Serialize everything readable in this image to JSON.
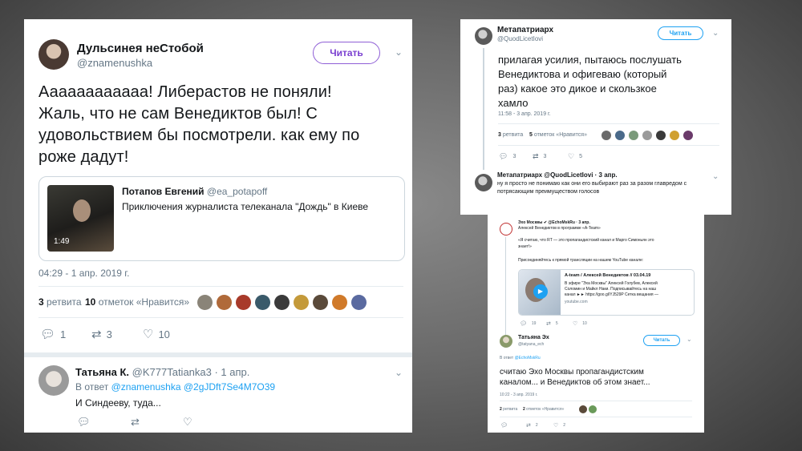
{
  "main": {
    "author_name": "Дульсинея неСтобой",
    "author_handle": "@znamenushka",
    "follow_label": "Читать",
    "text_lines": [
      "Аааааааааааа! Либерастов не поняли!",
      "Жаль, что не сам Венедиктов был! С",
      "удовольствием бы посмотрели. как ему по",
      "роже дадут!"
    ],
    "quote": {
      "name": "Потапов Евгений",
      "handle": "@ea_potapoff",
      "text": "Приключения журналиста телеканала \"Дождь\" в Киеве",
      "duration": "1:49"
    },
    "time": "04:29 - 1 апр. 2019 г.",
    "retweets_count": "3",
    "retweets_label": "ретвита",
    "likes_count": "10",
    "likes_label": "отметок «Нравится»",
    "action_replies": "1",
    "action_retweets": "3",
    "action_likes": "10",
    "reply": {
      "name": "Татьяна К.",
      "handle": "@K777Tatianka3 · 1 апр.",
      "in_reply_prefix": "В ответ",
      "in_reply_to": "@znamenushka @2gJDft7Se4M7O39",
      "text": "И Синдееву, туда..."
    }
  },
  "right_top": {
    "author_name": "Метапатриарх",
    "author_handle": "@QuodLicetIovi",
    "follow_label": "Читать",
    "text_lines": [
      "прилагая усилия, пытаюсь послушать",
      "Венедиктова и офигеваю (который",
      "раз) какое это дикое и скользкое",
      "хамло"
    ],
    "time": "11:58 - 3 апр. 2019 г.",
    "retweets_count": "3",
    "retweets_label": "ретвита",
    "likes_count": "5",
    "likes_label": "отметок «Нравится»",
    "action_replies": "3",
    "action_retweets": "3",
    "action_likes": "5",
    "reply": {
      "header": "Метапатриарх @QuodLicetIovi · 3 апр.",
      "line1": "ну я просто не понимаю как они его выбирают раз за разом главредом с",
      "line2": "потрясающим преимуществом голосов"
    }
  },
  "right_bottom": {
    "orig_header": "Эхо Москвы ✔ @EchoMskRu · 3 апр.",
    "orig_line1": "Алексей Венедиктов в программе «А-Team»",
    "orig_quote1": "«Я считаю, что RT — это пропагандистский канал и Марго Симоньян это",
    "orig_quote2": "знает!»",
    "orig_line3": "Присоединяйтесь к прямой трансляции на нашем YouTube канале:",
    "card": {
      "title": "A-team / Алексей Венедиктов // 03.04.19",
      "desc1": "В эфире \"Эха Москвы\" Алексей Голубев, Алексей",
      "desc2": "Соломин и Майкл Наки. Подписывайтесь на наш",
      "desc3": "канал ►► https://goo.gl/YJ529P Сетка вещания —",
      "domain": "youtube.com"
    },
    "orig_replies": "19",
    "orig_retweets": "5",
    "orig_likes": "10",
    "author_name": "Татьяна Эх",
    "author_handle": "@tatyana_ech",
    "follow_label": "Читать",
    "in_reply_prefix": "В ответ",
    "in_reply_to": "@EchoMskRu",
    "text_lines": [
      "считаю Эхо Москвы пропагандистским",
      "каналом... и Венедиктов об этом знает..."
    ],
    "time": "10:22 - 3 апр. 2019 г.",
    "retweets_count": "2",
    "retweets_label": "ретвита",
    "likes_count": "2",
    "likes_label": "отметок «Нравится»",
    "action_retweets": "2",
    "action_likes": "2"
  },
  "colors": {
    "accent": "#1da1f2",
    "follow_purple": "#7a3fd0",
    "text": "#14171a",
    "muted": "#657786"
  },
  "icons": [
    "reply-icon",
    "retweet-icon",
    "heart-icon",
    "chevron-down-icon",
    "play-icon",
    "verified-icon"
  ]
}
